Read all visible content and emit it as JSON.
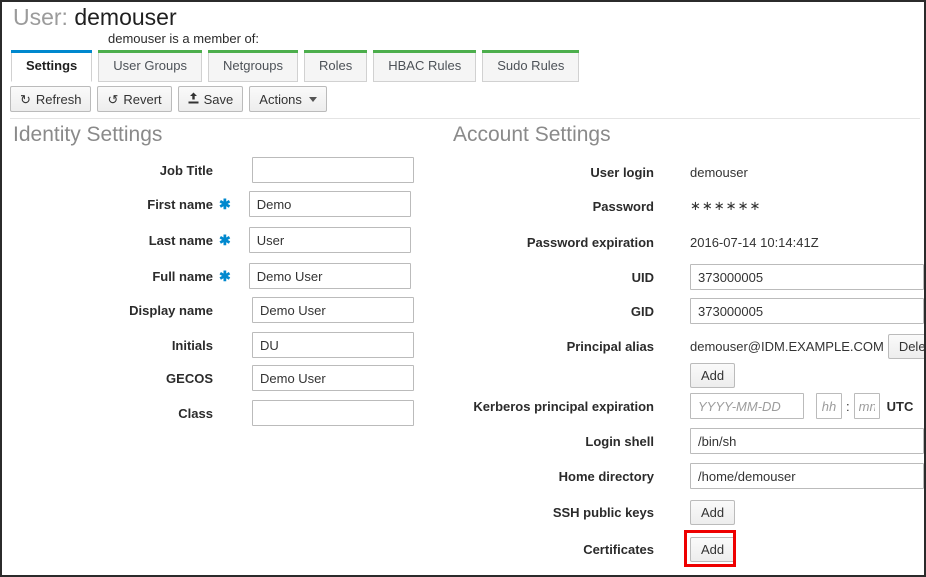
{
  "header": {
    "title_prefix": "User:",
    "title_value": "demouser",
    "member_of_text": "demouser is a member of:"
  },
  "tabs": [
    {
      "label": "Settings",
      "active": true,
      "accent": "#0088ce"
    },
    {
      "label": "User Groups",
      "active": false,
      "accent": "#4cae4c"
    },
    {
      "label": "Netgroups",
      "active": false,
      "accent": "#4cae4c"
    },
    {
      "label": "Roles",
      "active": false,
      "accent": "#4cae4c"
    },
    {
      "label": "HBAC Rules",
      "active": false,
      "accent": "#4cae4c"
    },
    {
      "label": "Sudo Rules",
      "active": false,
      "accent": "#4cae4c"
    }
  ],
  "toolbar": {
    "refresh_label": "Refresh",
    "refresh_icon": "refresh-icon",
    "revert_label": "Revert",
    "revert_icon": "undo-icon",
    "save_label": "Save",
    "save_icon": "upload-icon",
    "actions_label": "Actions",
    "actions_icon": "chevron-down-icon"
  },
  "identity": {
    "title": "Identity Settings",
    "fields": [
      {
        "label": "Job Title",
        "value": "",
        "required": false
      },
      {
        "label": "First name",
        "value": "Demo",
        "required": true
      },
      {
        "label": "Last name",
        "value": "User",
        "required": true
      },
      {
        "label": "Full name",
        "value": "Demo User",
        "required": true
      },
      {
        "label": "Display name",
        "value": "Demo User",
        "required": false
      },
      {
        "label": "Initials",
        "value": "DU",
        "required": false
      },
      {
        "label": "GECOS",
        "value": "Demo User",
        "required": false
      },
      {
        "label": "Class",
        "value": "",
        "required": false
      }
    ]
  },
  "account": {
    "title": "Account Settings",
    "user_login_label": "User login",
    "user_login_value": "demouser",
    "password_label": "Password",
    "password_value": "∗∗∗∗∗∗",
    "password_expiration_label": "Password expiration",
    "password_expiration_value": "2016-07-14 10:14:41Z",
    "uid_label": "UID",
    "uid_value": "373000005",
    "gid_label": "GID",
    "gid_value": "373000005",
    "principal_alias_label": "Principal alias",
    "principal_alias_value": "demouser@IDM.EXAMPLE.COM",
    "principal_alias_delete_label": "Delete",
    "principal_alias_add_label": "Add",
    "kerberos_label": "Kerberos principal expiration",
    "kerberos_date_value": "",
    "kerberos_date_placeholder": "YYYY-MM-DD",
    "kerberos_hour_value": "",
    "kerberos_hour_placeholder": "hh",
    "kerberos_minute_value": "",
    "kerberos_minute_placeholder": "mn",
    "kerberos_time_separator": ":",
    "kerberos_timezone": "UTC",
    "login_shell_label": "Login shell",
    "login_shell_value": "/bin/sh",
    "home_directory_label": "Home directory",
    "home_directory_value": "/home/demouser",
    "ssh_keys_label": "SSH public keys",
    "ssh_keys_add_label": "Add",
    "certificates_label": "Certificates",
    "certificates_add_label": "Add"
  },
  "annotation": {
    "highlight_color": "#ee0000",
    "highlight_target": "certificates-add-button"
  }
}
